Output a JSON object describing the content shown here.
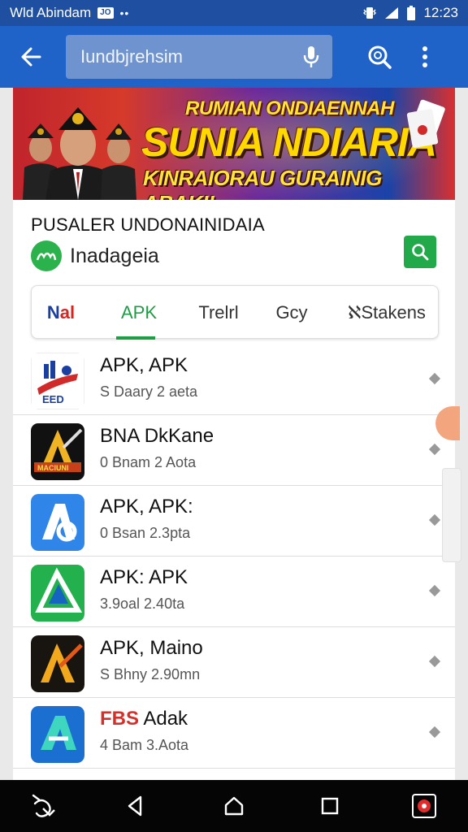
{
  "status_bar": {
    "carrier": "Wld Abindam",
    "badge": "JO",
    "dots": "••",
    "time": "12:23"
  },
  "app_bar": {
    "search_text": "Iundbjrehsim",
    "icons": [
      "back-arrow-icon",
      "mic-icon",
      "search-zoom-icon",
      "more-vert-icon"
    ]
  },
  "banner": {
    "line1": "RUMIAN ONDIAENNAH",
    "line2": "SUNIA NDIARIA",
    "line3": "KINRAIORAU GURAINIG ABAKI!"
  },
  "page": {
    "title": "PUSALER UNDONAINIDAIA",
    "brand": "Inadageia",
    "brand_color": "#2bb24c",
    "accent": "#1e9e44"
  },
  "tabs": {
    "nal_part1": "N",
    "nal_part2": "al",
    "apk": "APK",
    "trend": "Trelrl",
    "gcy": "Gcy",
    "stak": "ℵStakens",
    "selected": "APK"
  },
  "list": [
    {
      "title": "APK, APK",
      "subtitle": "S Daary 2 aeta",
      "icon": "eed-logo-icon"
    },
    {
      "title": "BNA DkKane",
      "subtitle": "0 Bnam 2 Aota",
      "icon": "gold-a-game-icon"
    },
    {
      "title": "APK, APK:",
      "subtitle": "0 Bsan 2.3pta",
      "icon": "blue-a-app-icon"
    },
    {
      "title": "APK: APK",
      "subtitle": "3.9oal 2.40ta",
      "icon": "green-a-app-icon"
    },
    {
      "title": "APK, Maino",
      "subtitle": "S Bhny 2.90mn",
      "icon": "gold-a-dark-icon"
    },
    {
      "title": "Adak",
      "subtitle": "4 Bam 3.Aota",
      "icon": "teal-a-app-icon",
      "prefix": "FBS"
    }
  ],
  "nav_bar": {
    "icons": [
      "gesture-icon",
      "back-triangle-icon",
      "home-circle-icon",
      "recents-square-icon",
      "screen-record-icon"
    ]
  }
}
